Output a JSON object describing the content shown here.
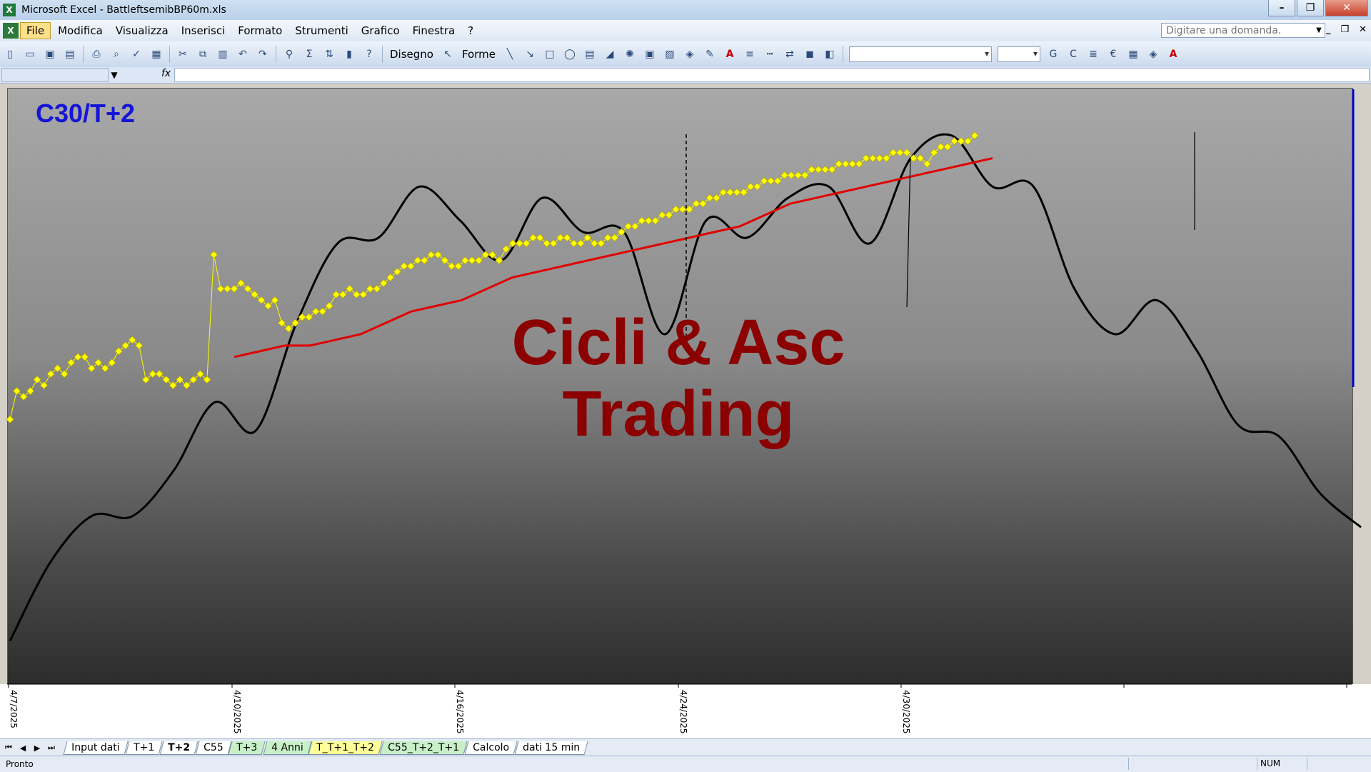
{
  "window": {
    "app_icon": "X",
    "title": "Microsoft Excel - BattleftsemibBP60m.xls"
  },
  "menu": {
    "items": [
      "File",
      "Modifica",
      "Visualizza",
      "Inserisci",
      "Formato",
      "Strumenti",
      "Grafico",
      "Finestra",
      "?"
    ],
    "help_placeholder": "Digitare una domanda."
  },
  "toolbar": {
    "disegno_label": "Disegno",
    "forme_label": "Forme",
    "bold_label": "G",
    "italic_label": "C"
  },
  "chart": {
    "title": "C30/T+2",
    "watermark_line1": "Cicli & Asc",
    "watermark_line2": "Trading",
    "x_tick_labels": [
      "4/7/2025",
      "4/10/2025",
      "4/16/2025",
      "4/24/2025",
      "4/30/2025"
    ],
    "colors": {
      "title": "#1515d6",
      "watermark": "#8b0000",
      "price_series": "#ffff00",
      "moving_average": "#e00000",
      "cycle_line": "#000000",
      "right_marker": "#0000cc"
    }
  },
  "chart_data": {
    "type": "line",
    "title": "C30/T+2",
    "xlabel": "",
    "ylabel": "",
    "x_categories": [
      "4/7/2025",
      "4/10/2025",
      "4/16/2025",
      "4/24/2025",
      "4/30/2025"
    ],
    "series": [
      {
        "name": "",
        "style": "yellow-diamond-markers",
        "values": [
          0.45,
          0.5,
          0.49,
          0.5,
          0.52,
          0.51,
          0.53,
          0.54,
          0.53,
          0.55,
          0.56,
          0.56,
          0.54,
          0.55,
          0.54,
          0.55,
          0.57,
          0.58,
          0.59,
          0.58,
          0.52,
          0.53,
          0.53,
          0.52,
          0.51,
          0.52,
          0.51,
          0.52,
          0.53,
          0.52,
          0.74,
          0.68,
          0.68,
          0.68,
          0.69,
          0.68,
          0.67,
          0.66,
          0.65,
          0.66,
          0.62,
          0.61,
          0.62,
          0.63,
          0.63,
          0.64,
          0.64,
          0.65,
          0.67,
          0.67,
          0.68,
          0.67,
          0.67,
          0.68,
          0.68,
          0.69,
          0.7,
          0.71,
          0.72,
          0.72,
          0.73,
          0.73,
          0.74,
          0.74,
          0.73,
          0.72,
          0.72,
          0.73,
          0.73,
          0.73,
          0.74,
          0.74,
          0.73,
          0.75,
          0.76,
          0.76,
          0.76,
          0.77,
          0.77,
          0.76,
          0.76,
          0.77,
          0.77,
          0.76,
          0.76,
          0.77,
          0.76,
          0.76,
          0.77,
          0.77,
          0.78,
          0.79,
          0.79,
          0.8,
          0.8,
          0.8,
          0.81,
          0.81,
          0.82,
          0.82,
          0.82,
          0.83,
          0.83,
          0.84,
          0.84,
          0.85,
          0.85,
          0.85,
          0.85,
          0.86,
          0.86,
          0.87,
          0.87,
          0.87,
          0.88,
          0.88,
          0.88,
          0.88,
          0.89,
          0.89,
          0.89,
          0.89,
          0.9,
          0.9,
          0.9,
          0.9,
          0.91,
          0.91,
          0.91,
          0.91,
          0.92,
          0.92,
          0.92,
          0.91,
          0.91,
          0.9,
          0.92,
          0.93,
          0.93,
          0.94,
          0.94,
          0.94,
          0.95
        ]
      },
      {
        "name": "",
        "style": "red-line",
        "values": [
          0.56,
          0.57,
          0.58,
          0.58,
          0.59,
          0.6,
          0.62,
          0.64,
          0.65,
          0.66,
          0.68,
          0.7,
          0.71,
          0.72,
          0.73,
          0.74,
          0.75,
          0.76,
          0.77,
          0.78,
          0.79,
          0.81,
          0.83,
          0.84,
          0.85,
          0.86,
          0.87,
          0.88,
          0.89,
          0.9,
          0.91
        ]
      },
      {
        "name": "",
        "style": "black-smooth-line",
        "values": [
          0.06,
          0.2,
          0.28,
          0.28,
          0.36,
          0.48,
          0.43,
          0.62,
          0.76,
          0.77,
          0.86,
          0.8,
          0.73,
          0.84,
          0.78,
          0.78,
          0.6,
          0.8,
          0.77,
          0.84,
          0.86,
          0.76,
          0.91,
          0.95,
          0.86,
          0.86,
          0.68,
          0.6,
          0.66,
          0.57,
          0.44,
          0.42,
          0.32,
          0.26
        ]
      }
    ]
  },
  "sheet_tabs": [
    {
      "label": "Input dati",
      "color": "#ffffff",
      "active": false
    },
    {
      "label": "T+1",
      "color": "#ffffff",
      "active": false
    },
    {
      "label": "T+2",
      "color": "#ffffff",
      "active": true
    },
    {
      "label": "C55",
      "color": "#ffffff",
      "active": false
    },
    {
      "label": "T+3",
      "color": "#c8f0c8",
      "active": false
    },
    {
      "label": "4 Anni",
      "color": "#c8f0c8",
      "active": false
    },
    {
      "label": "T_T+1_T+2",
      "color": "#ffff99",
      "active": false
    },
    {
      "label": "C55_T+2_T+1",
      "color": "#c8f0c8",
      "active": false
    },
    {
      "label": "Calcolo",
      "color": "#ffffff",
      "active": false
    },
    {
      "label": "dati 15 min",
      "color": "#ffffff",
      "active": false
    }
  ],
  "status": {
    "text": "Pronto",
    "num": "NUM"
  }
}
